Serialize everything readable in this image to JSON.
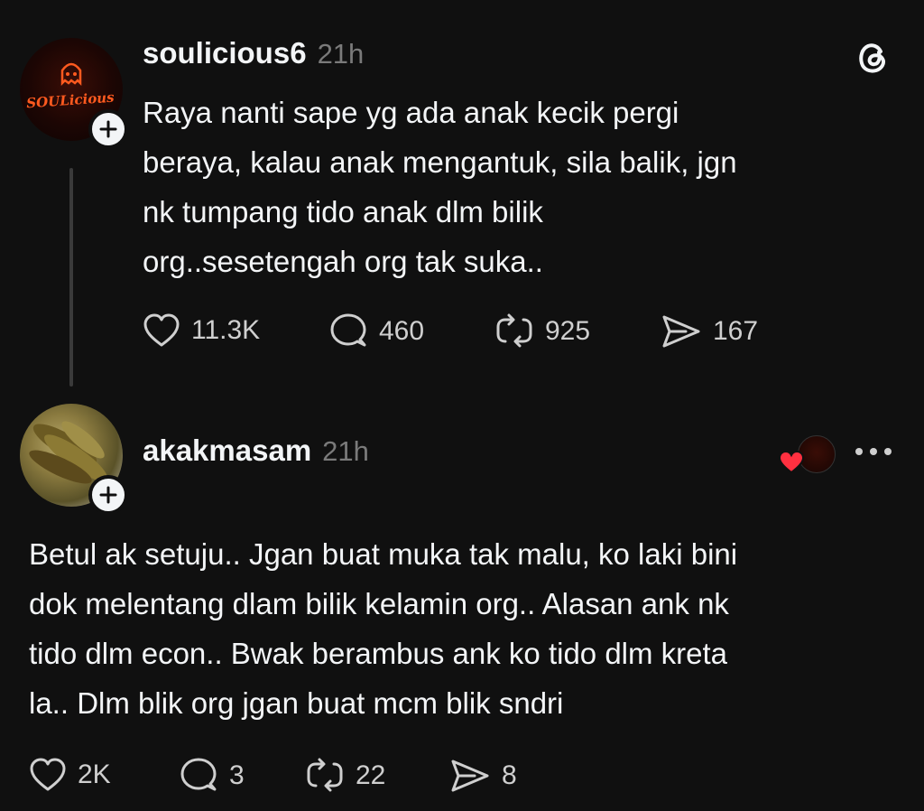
{
  "post1": {
    "username": "soulicious6",
    "time": "21h",
    "text_lines": [
      "Raya nanti sape yg ada anak kecik pergi",
      "beraya, kalau anak mengantuk, sila balik, jgn",
      "nk tumpang tido anak dlm bilik",
      "org..sesetengah org tak suka.."
    ],
    "avatar_logo_text": "SOULicious",
    "likes": "11.3K",
    "replies": "460",
    "reposts": "925",
    "shares": "167"
  },
  "post2": {
    "username": "akakmasam",
    "time": "21h",
    "text_lines": [
      "Betul ak setuju.. Jgan buat muka tak malu, ko laki bini",
      "dok melentang dlam bilik kelamin org.. Alasan ank nk",
      "tido dlm econ.. Bwak berambus ank ko tido dlm kreta",
      "la.. Dlm blik org jgan buat mcm blik sndri"
    ],
    "likes": "2K",
    "replies": "3",
    "reposts": "22",
    "shares": "8"
  },
  "icons": {
    "app_logo": "threads-logo-icon",
    "like": "heart-icon",
    "reply": "comment-icon",
    "repost": "repost-icon",
    "share": "share-icon",
    "more": "more-dots-icon",
    "liked_by_author": "red-heart-icon"
  },
  "colors": {
    "background": "#101010",
    "text": "#f3f5f7",
    "muted": "#7a7a7a",
    "heart_red": "#ff3040",
    "neon_orange": "#ff5a1f"
  }
}
